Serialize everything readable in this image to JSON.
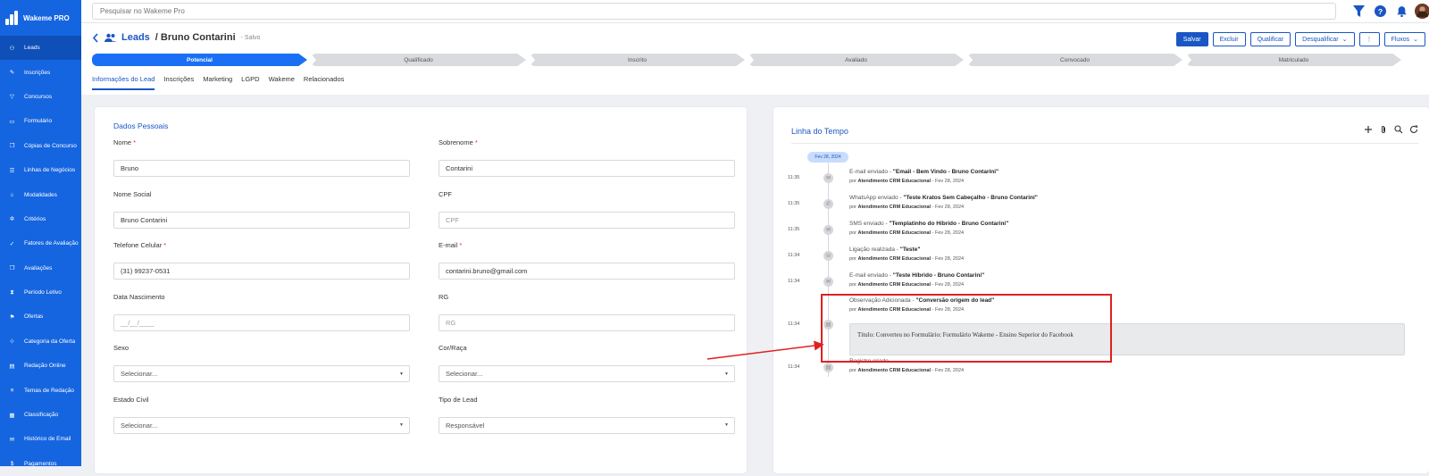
{
  "app": {
    "name": "Wakeme PRO"
  },
  "sidebar": {
    "items": [
      {
        "label": "Leads",
        "icon": "users-icon",
        "active": true
      },
      {
        "label": "Inscrições",
        "icon": "pencil-icon"
      },
      {
        "label": "Concursos",
        "icon": "filter-icon"
      },
      {
        "label": "Formulário",
        "icon": "form-icon"
      },
      {
        "label": "Cópias de Concurso",
        "icon": "copy-icon"
      },
      {
        "label": "Linhas de Negócios",
        "icon": "list-icon"
      },
      {
        "label": "Modalidades",
        "icon": "graduation-cap-icon"
      },
      {
        "label": "Critérios",
        "icon": "settings-icon"
      },
      {
        "label": "Fatores de Avaliação",
        "icon": "check-icon"
      },
      {
        "label": "Avaliações",
        "icon": "copy-icon"
      },
      {
        "label": "Período Letivo",
        "icon": "hourglass-icon"
      },
      {
        "label": "Ofertas",
        "icon": "flag-icon"
      },
      {
        "label": "Categoria da Oferta",
        "icon": "sitemap-icon"
      },
      {
        "label": "Redação Online",
        "icon": "document-icon"
      },
      {
        "label": "Temas de Redação",
        "icon": "lines-icon"
      },
      {
        "label": "Classificação",
        "icon": "ranking-icon"
      },
      {
        "label": "Histórico de Email",
        "icon": "mail-icon"
      },
      {
        "label": "Pagamentos",
        "icon": "dollar-icon"
      }
    ]
  },
  "topbar": {
    "search_placeholder": "Pesquisar no Wakeme Pro"
  },
  "header": {
    "section": "Leads",
    "lead_name": "/ Bruno Contarini",
    "status": "- Salvo",
    "buttons": {
      "save": "Salvar",
      "delete": "Excluir",
      "qualify": "Qualificar",
      "disqualify": "Desqualificar",
      "more": "⋮",
      "flows": "Fluxos"
    }
  },
  "steps": [
    "Potencial",
    "Qualificado",
    "Inscrito",
    "Avaliado",
    "Convocado",
    "Matriculado"
  ],
  "tabs": [
    "Informações do Lead",
    "Inscrições",
    "Marketing",
    "LGPD",
    "Wakeme",
    "Relacionados"
  ],
  "personal": {
    "section_title": "Dados Pessoais",
    "fields": [
      {
        "label": "Nome",
        "required": "*",
        "value": "Bruno"
      },
      {
        "label": "Sobrenome",
        "required": "*",
        "value": "Contarini"
      },
      {
        "label": "Nome Social",
        "required": "",
        "value": "Bruno Contarini"
      },
      {
        "label": "CPF",
        "required": "",
        "placeholder": "CPF"
      },
      {
        "label": "Telefone Celular",
        "required": "*",
        "value": "(31) 99237-0531"
      },
      {
        "label": "E-mail",
        "required": "*",
        "value": "contarini.bruno@gmail.com"
      },
      {
        "label": "Data Nascimento",
        "required": "",
        "placeholder": "__/__/____"
      },
      {
        "label": "RG",
        "required": "",
        "placeholder": "RG"
      },
      {
        "label": "Sexo",
        "required": "",
        "value": "Selecionar...",
        "select": true
      },
      {
        "label": "Cor/Raça",
        "required": "",
        "value": "Selecionar...",
        "select": true
      },
      {
        "label": "Estado Civil",
        "required": "",
        "value": "Selecionar...",
        "select": true
      },
      {
        "label": "Tipo de Lead",
        "required": "",
        "value": "Responsável",
        "select": true
      }
    ]
  },
  "timeline": {
    "title": "Linha do Tempo",
    "date": "Fev 28, 2024",
    "events": [
      {
        "time": "11:35",
        "prefix": "E-mail enviado - ",
        "subject": "\"Email - Bem Vindo - Bruno Contarini\"",
        "by": "Atendimento CRM Educacional",
        "date": "Fev 28, 2024"
      },
      {
        "time": "11:35",
        "prefix": "WhatsApp enviado - ",
        "subject": "\"Teste Kratos Sem Cabeçalho - Bruno Contarini\"",
        "by": "Atendimento CRM Educacional",
        "date": "Fev 28, 2024"
      },
      {
        "time": "11:35",
        "prefix": "SMS enviado - ",
        "subject": "\"Templatinho do Híbrido - Bruno Contarini\"",
        "by": "Atendimento CRM Educacional",
        "date": "Fev 28, 2024"
      },
      {
        "time": "11:34",
        "prefix": "Ligação realizada - ",
        "subject": "\"Teste\"",
        "by": "Atendimento CRM Educacional",
        "date": "Fev 28, 2024"
      },
      {
        "time": "11:34",
        "prefix": "E-mail enviado - ",
        "subject": "\"Teste Híbrido - Bruno Contarini\"",
        "by": "Atendimento CRM Educacional",
        "date": "Fev 28, 2024"
      },
      {
        "time": "11:34",
        "prefix": "Observação Adicionada - ",
        "subject": "\"Conversão origem do lead\"",
        "by": "Atendimento CRM Educacional",
        "date": "Fev 28, 2024",
        "note": "Título: Converteu no Formulário: Formulário Wakeme - Ensino Superior do Facebook"
      },
      {
        "time": "11:34",
        "prefix": "Registro criado",
        "subject": "",
        "by": "Atendimento CRM Educacional",
        "date": "Fev 28, 2024"
      }
    ],
    "by_prefix": "por "
  },
  "colors": {
    "primary": "#1565e0",
    "accent": "#1a56c4",
    "highlight": "#e02020"
  }
}
